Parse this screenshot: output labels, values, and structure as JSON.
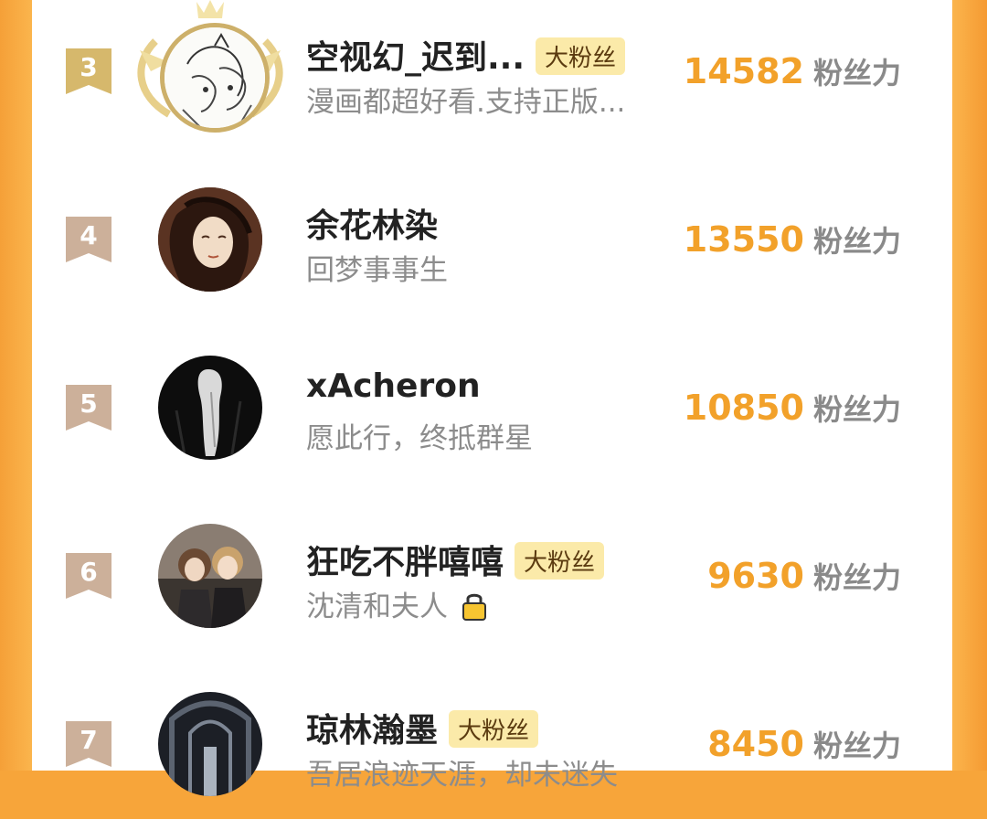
{
  "rows": [
    {
      "rank": "3",
      "name": "空视幻_迟到...",
      "badge": "大粉丝",
      "subtitle": "漫画都超好看.支持正版...",
      "score": "14582",
      "unit": "粉丝力",
      "avatar": "sketch-avatar"
    },
    {
      "rank": "4",
      "name": "余花林染",
      "badge": "",
      "subtitle": "回梦事事生",
      "score": "13550",
      "unit": "粉丝力",
      "avatar": "long-hair-avatar"
    },
    {
      "rank": "5",
      "name": "xAcheron",
      "badge": "",
      "subtitle": "愿此行，终抵群星",
      "score": "10850",
      "unit": "粉丝力",
      "avatar": "dark-figure-avatar"
    },
    {
      "rank": "6",
      "name": "狂吃不胖嘻嘻",
      "badge": "大粉丝",
      "subtitle": "沈清和夫人",
      "score": "9630",
      "unit": "粉丝力",
      "avatar": "two-people-avatar",
      "subtitle_icon": "lock-icon"
    },
    {
      "rank": "7",
      "name": "琼林瀚墨",
      "badge": "大粉丝",
      "subtitle": "吾居浪迹天涯，却未迷失",
      "score": "8450",
      "unit": "粉丝力",
      "avatar": "corridor-avatar"
    }
  ],
  "colors": {
    "frame": "#f7a53a",
    "score": "#f2a12a",
    "rank3": "#d4b56a",
    "rank_other": "#c9ae96",
    "badge_bg": "#fbeaa9"
  }
}
